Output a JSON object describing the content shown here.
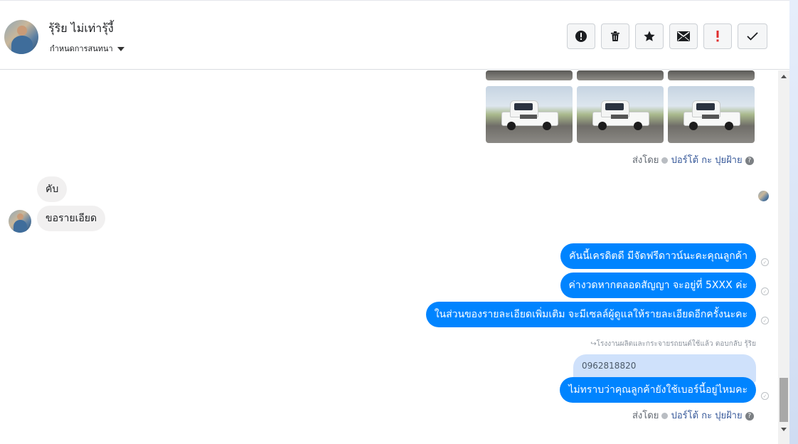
{
  "header": {
    "contact_name": "รุ้ริย ไม่เท่ารุ้งี้",
    "assign_label": "กำหนดการสนทนา",
    "toolbar": {
      "icons": [
        "alert-circle-icon",
        "trash-icon",
        "star-icon",
        "envelope-icon",
        "exclamation-icon",
        "check-icon"
      ],
      "colors": {
        "exclamation": "#e02d2d",
        "default": "#1c1e21"
      }
    }
  },
  "thread": {
    "sent_by_1": {
      "prefix": "ส่งโดย",
      "agent": "ปอร์โต้ กะ ปุยฝ้าย"
    },
    "incoming": [
      "คับ",
      "ขอรายเอียด"
    ],
    "outgoing": [
      "คันนี้เครดิตดี มีจัดฟรีดาวน์นะคะคุณลูกค้า",
      "ค่างวดหากตลอดสัญญา จะอยู่ที่ 5XXX ค่ะ",
      "ในส่วนของรายละเอียดเพิ่มเติม จะมีเซลล์ผู้ดูแลให้รายละเอียดอีกครั้งนะคะ"
    ],
    "reply_note": "โรงงานผลิตและกระจายรถยนต์ใช้แล้ว ตอบกลับ รุ้ริย",
    "quoted": "0962818820",
    "last_outgoing": "ไม่ทราบว่าคุณลูกค้ายังใช้เบอร์นี้อยู่ไหมคะ",
    "sent_by_2": {
      "prefix": "ส่งโดย",
      "agent": "ปอร์โต้ กะ ปุยฝ้าย"
    }
  },
  "colors": {
    "outgoing_bubble": "#0084ff",
    "incoming_bubble": "#f1f0f0",
    "quote_bubble": "#cfe1fb"
  }
}
